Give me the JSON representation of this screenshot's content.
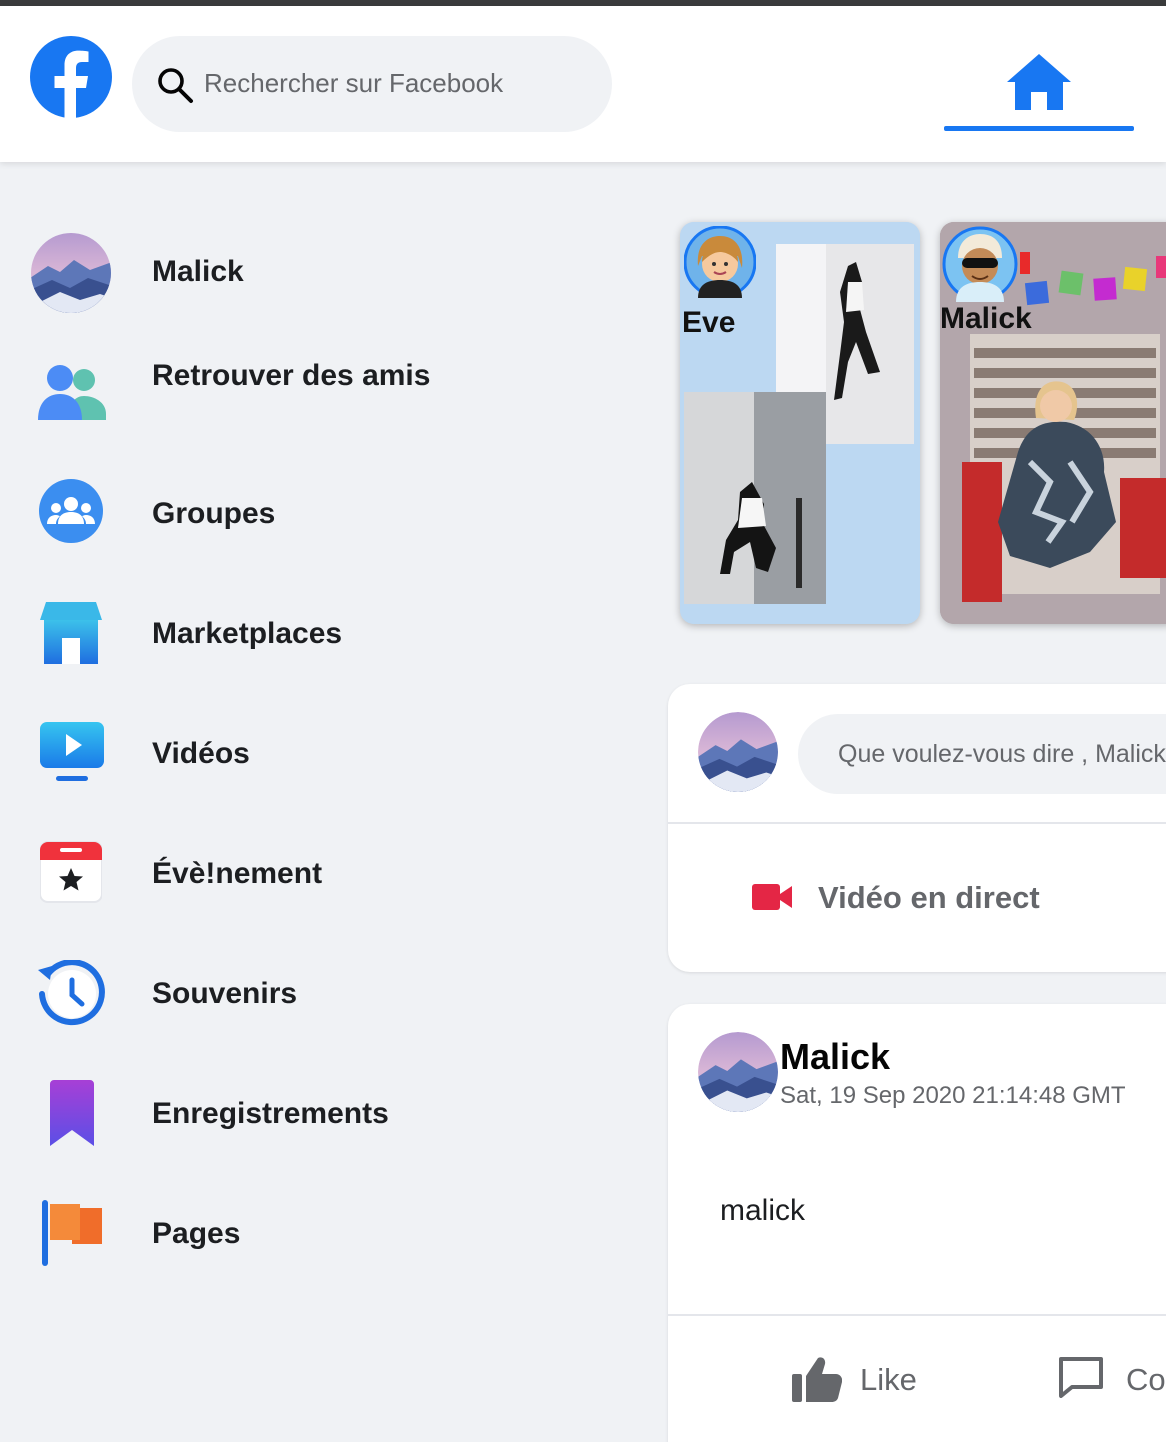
{
  "header": {
    "search_placeholder": "Rechercher sur Facebook"
  },
  "sidebar": {
    "items": [
      {
        "label": "Malick",
        "icon": "profile-avatar"
      },
      {
        "label": "Retrouver des amis",
        "icon": "friends-icon"
      },
      {
        "label": "Groupes",
        "icon": "groups-icon"
      },
      {
        "label": "Marketplaces",
        "icon": "marketplace-icon"
      },
      {
        "label": "Vidéos",
        "icon": "video-icon"
      },
      {
        "label": "Évè!nement",
        "icon": "calendar-icon"
      },
      {
        "label": "Souvenirs",
        "icon": "memories-icon"
      },
      {
        "label": "Enregistrements",
        "icon": "bookmark-icon"
      },
      {
        "label": "Pages",
        "icon": "flag-icon"
      }
    ]
  },
  "stories": [
    {
      "name": "Eve"
    },
    {
      "name": "Malick"
    }
  ],
  "composer": {
    "placeholder": "Que voulez-vous dire , Malick ?",
    "live_label": "Vidéo en direct"
  },
  "post": {
    "author": "Malick",
    "timestamp": "Sat, 19 Sep 2020 21:14:48 GMT",
    "body": "malick",
    "like_label": "Like",
    "comment_label": "Co"
  },
  "colors": {
    "accent": "#1877f2",
    "background": "#f0f2f5",
    "live_red": "#e42645"
  }
}
